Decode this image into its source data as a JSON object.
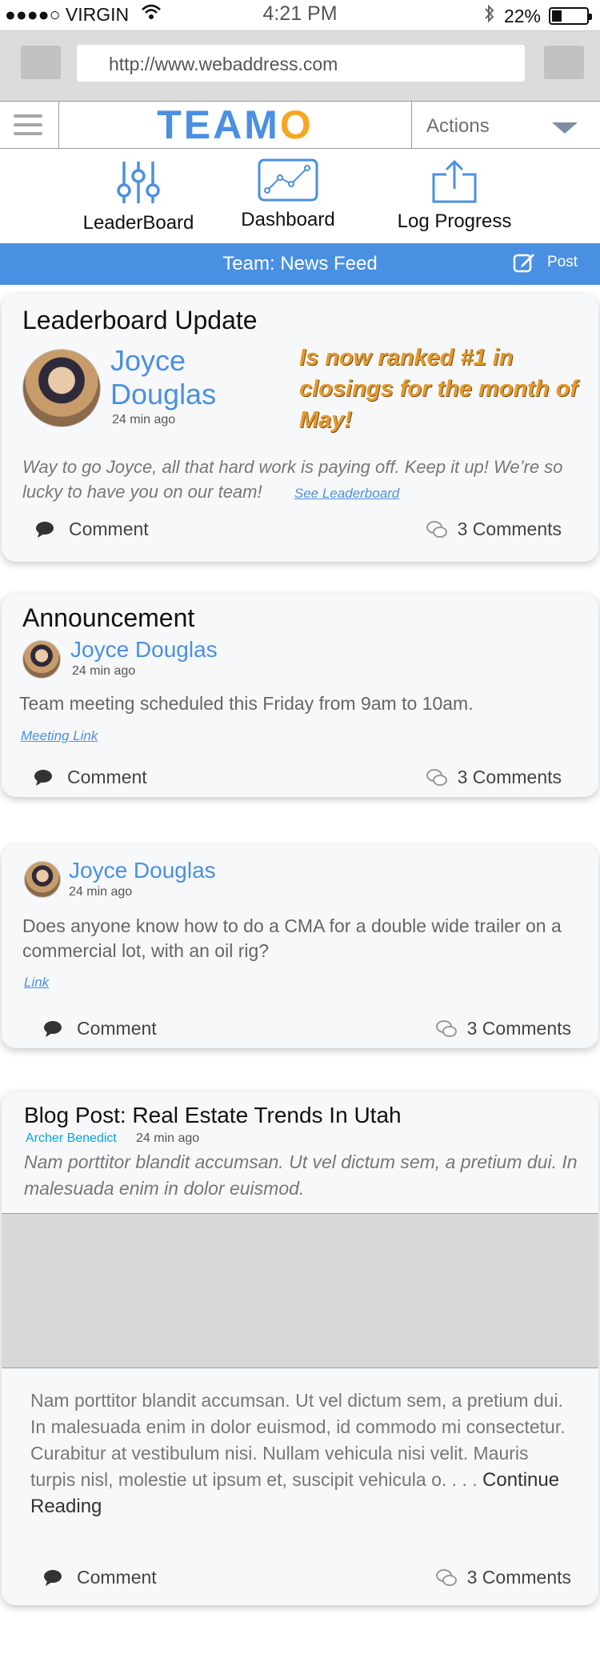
{
  "status": {
    "carrier": "●●●●○ VIRGIN",
    "time": "4:21 PM",
    "battery": "22%"
  },
  "browser": {
    "url": "http://www.webaddress.com"
  },
  "header": {
    "logo_main": "TEAM",
    "logo_accent": "O",
    "actions_label": "Actions"
  },
  "nav": [
    {
      "label": "LeaderBoard",
      "icon": "sliders-icon"
    },
    {
      "label": "Dashboard",
      "icon": "line-chart-icon"
    },
    {
      "label": "Log Progress",
      "icon": "share-upload-icon"
    }
  ],
  "feedbar": {
    "title": "Team:  News Feed",
    "post_label": "Post"
  },
  "cards": {
    "leaderboard": {
      "title": "Leaderboard Update",
      "name_first": "Joyce",
      "name_last": "Douglas",
      "time": "24 min ago",
      "headline": "Is now ranked #1 in closings for the month of May!",
      "body": "Way to go Joyce, all that hard work is paying off.  Keep it up! We’re so lucky to have you on our team!",
      "link": "See Leaderboard",
      "comment_label": "Comment",
      "count_label": "3 Comments"
    },
    "announcement": {
      "title": "Announcement",
      "name": "Joyce Douglas",
      "time": "24 min ago",
      "body": "Team meeting scheduled this Friday from 9am to 10am.",
      "link": "Meeting Link",
      "comment_label": "Comment",
      "count_label": "3 Comments"
    },
    "question": {
      "name": "Joyce Douglas",
      "time": "24 min ago",
      "body": "Does anyone know how to do a CMA for a double wide trailer on a commercial lot, with an oil rig?",
      "link": "Link",
      "comment_label": "Comment",
      "count_label": "3 Comments"
    },
    "blog": {
      "title": "Blog Post: Real Estate Trends In Utah",
      "author": "Archer Benedict",
      "time": "24 min ago",
      "summary": "Nam porttitor blandit accumsan. Ut vel dictum sem, a pretium dui. In malesuada enim in dolor euismod.",
      "excerpt": "Nam porttitor blandit accumsan. Ut vel dictum sem, a pretium dui. In malesuada enim in dolor euismod, id commodo mi consectetur. Curabitur at vestibulum nisi. Nullam vehicula nisi velit. Mauris turpis nisl, molestie ut ipsum et, suscipit vehicula o. . . .",
      "continue": "Continue Reading",
      "comment_label": "Comment",
      "count_label": "3 Comments"
    }
  },
  "colors": {
    "accent": "#4a90e2",
    "logo_o": "#f5a623",
    "headline": "#e39a2f"
  }
}
